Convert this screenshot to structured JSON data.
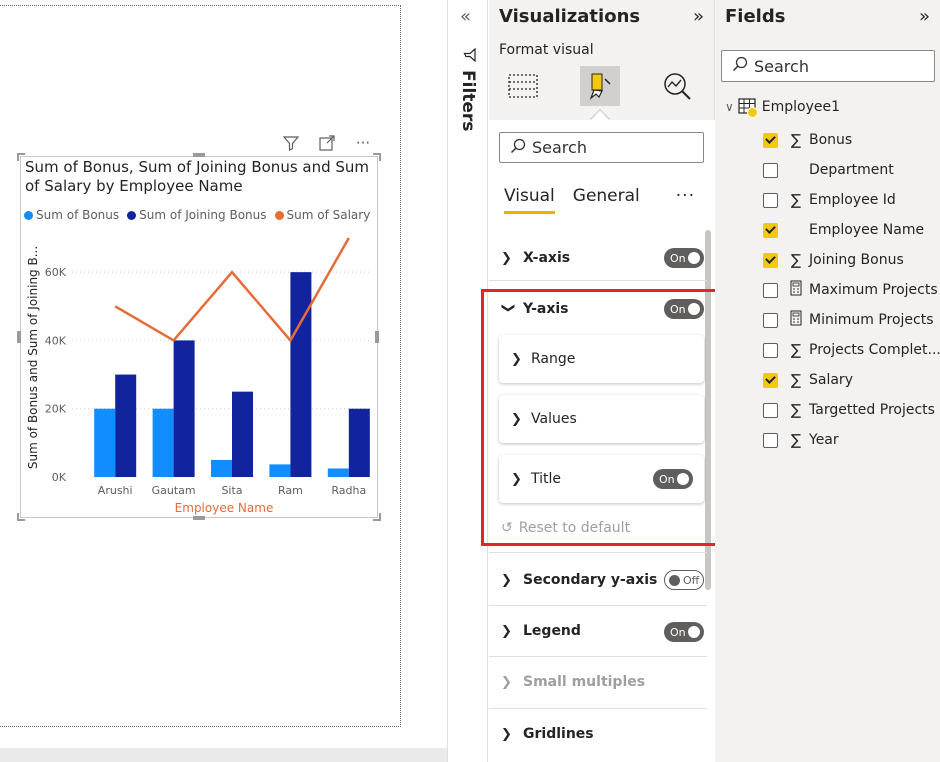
{
  "chart": {
    "header_icons": [
      "filter-icon",
      "focus-mode-icon",
      "more-options-icon"
    ],
    "more_label": "···"
  },
  "chart_data": {
    "type": "bar",
    "title": "Sum of Bonus, Sum of Joining Bonus and Sum of Salary by Employee Name",
    "xlabel": "Employee Name",
    "ylabel": "Sum of Bonus and Sum of Joining B...",
    "categories": [
      "Arushi",
      "Gautam",
      "Sita",
      "Ram",
      "Radha"
    ],
    "yticks": [
      "0K",
      "20K",
      "40K",
      "60K"
    ],
    "ylim": [
      0,
      70000
    ],
    "legend_position": "top-left",
    "grid": true,
    "series": [
      {
        "name": "Sum of Bonus",
        "type": "bar",
        "color": "#118dff",
        "values": [
          20000,
          20000,
          5000,
          3700,
          2500
        ]
      },
      {
        "name": "Sum of Joining Bonus",
        "type": "bar",
        "color": "#12239e",
        "values": [
          30000,
          40000,
          25000,
          60000,
          20000
        ]
      },
      {
        "name": "Sum of Salary",
        "type": "line",
        "color": "#e66c37",
        "values": [
          50000,
          40000,
          60000,
          40000,
          70000
        ]
      }
    ]
  },
  "filters": {
    "collapse_icon": "«",
    "label": "Filters"
  },
  "visualizations": {
    "title": "Visualizations",
    "expand_icon": "»",
    "format_label": "Format visual",
    "search_placeholder": "Search",
    "tabs": [
      "Visual",
      "General"
    ],
    "more": "···",
    "sections": {
      "xaxis": "X-axis",
      "yaxis": "Y-axis",
      "secondary": "Secondary y-axis",
      "legend": "Legend",
      "small_multiples": "Small multiples",
      "gridlines": "Gridlines"
    },
    "cards": {
      "range": "Range",
      "values": "Values",
      "title": "Title"
    },
    "reset": "Reset to default",
    "toggle_on": "On",
    "toggle_off": "Off"
  },
  "fields": {
    "title": "Fields",
    "expand_icon": "»",
    "search_placeholder": "Search",
    "table_name": "Employee1",
    "items": [
      {
        "label": "Bonus",
        "checked": true,
        "sigma": true
      },
      {
        "label": "Department",
        "checked": false,
        "sigma": false
      },
      {
        "label": "Employee Id",
        "checked": false,
        "sigma": true
      },
      {
        "label": "Employee Name",
        "checked": true,
        "sigma": false
      },
      {
        "label": "Joining Bonus",
        "checked": true,
        "sigma": true
      },
      {
        "label": "Maximum Projects",
        "checked": false,
        "calc": true
      },
      {
        "label": "Minimum Projects",
        "checked": false,
        "calc": true
      },
      {
        "label": "Projects Complet...",
        "checked": false,
        "sigma": true
      },
      {
        "label": "Salary",
        "checked": true,
        "sigma": true
      },
      {
        "label": "Targetted Projects",
        "checked": false,
        "sigma": true
      },
      {
        "label": "Year",
        "checked": false,
        "sigma": true
      }
    ]
  }
}
